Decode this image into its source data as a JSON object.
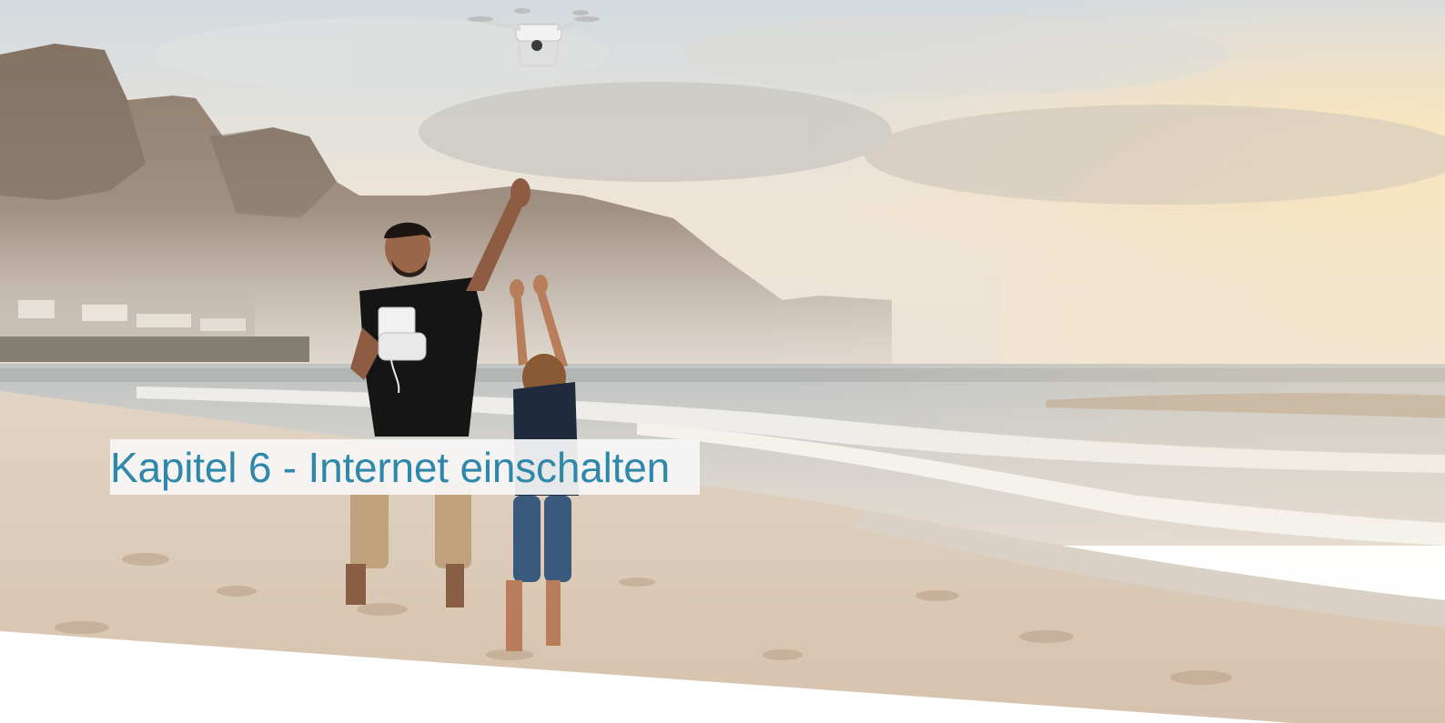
{
  "slide": {
    "title": "Kapitel 6 - Internet einschalten"
  },
  "photo": {
    "description_icon": "beach-drone-photo",
    "colors": {
      "sky_top": "#d9dfe2",
      "sky_glow": "#f6e7c8",
      "sun": "#fbe6b8",
      "mountain": "#8a7a6a",
      "sea": "#c9cdcf",
      "sand": "#e6d6c6",
      "title_color": "#2f87a9",
      "title_bg": "#f6f6f6"
    }
  }
}
